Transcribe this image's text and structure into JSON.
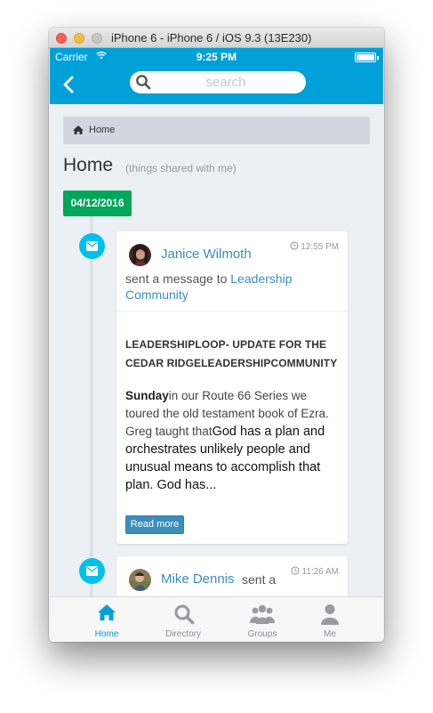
{
  "window": {
    "title": "iPhone 6 - iPhone 6 / iOS 9.3 (13E230)"
  },
  "statusbar": {
    "carrier": "Carrier",
    "time": "9:25 PM",
    "battery_level": 1.0
  },
  "navbar": {
    "back_icon": "chevron-left-icon",
    "search_placeholder": "search"
  },
  "breadcrumb": {
    "icon": "home-icon",
    "label": "Home"
  },
  "page": {
    "title": "Home",
    "subtitle": "(things shared with me)"
  },
  "timeline": {
    "date": "04/12/2016",
    "items": [
      {
        "author": "Janice Wilmoth",
        "time": "12:55 PM",
        "action_prefix": "sent a message to",
        "target": "Leadership Community",
        "message_title": "LEADERSHIPLOOP- UPDATE FOR THE CEDAR RIDGELEADERSHIPCOMMUNITY",
        "body_bold": "Sunday",
        "body_text": "in our Route 66 Series we toured the old testament book of Ezra. Greg taught that",
        "body_emphasis": "God has a plan and orchestrates unlikely people and unusual means to accomplish that plan. God has...",
        "read_more": "Read more"
      },
      {
        "author": "Mike Dennis",
        "time": "11:26 AM",
        "action_prefix": "sent a"
      }
    ]
  },
  "tabbar": {
    "tabs": [
      {
        "label": "Home",
        "icon": "home-icon",
        "active": true
      },
      {
        "label": "Directory",
        "icon": "search-icon",
        "active": false
      },
      {
        "label": "Groups",
        "icon": "groups-icon",
        "active": false
      },
      {
        "label": "Me",
        "icon": "person-icon",
        "active": false
      }
    ]
  },
  "colors": {
    "accent": "#00a0d8",
    "date_badge": "#00a65a",
    "link": "#3c8dbc",
    "timeline_icon": "#00c0ef"
  }
}
